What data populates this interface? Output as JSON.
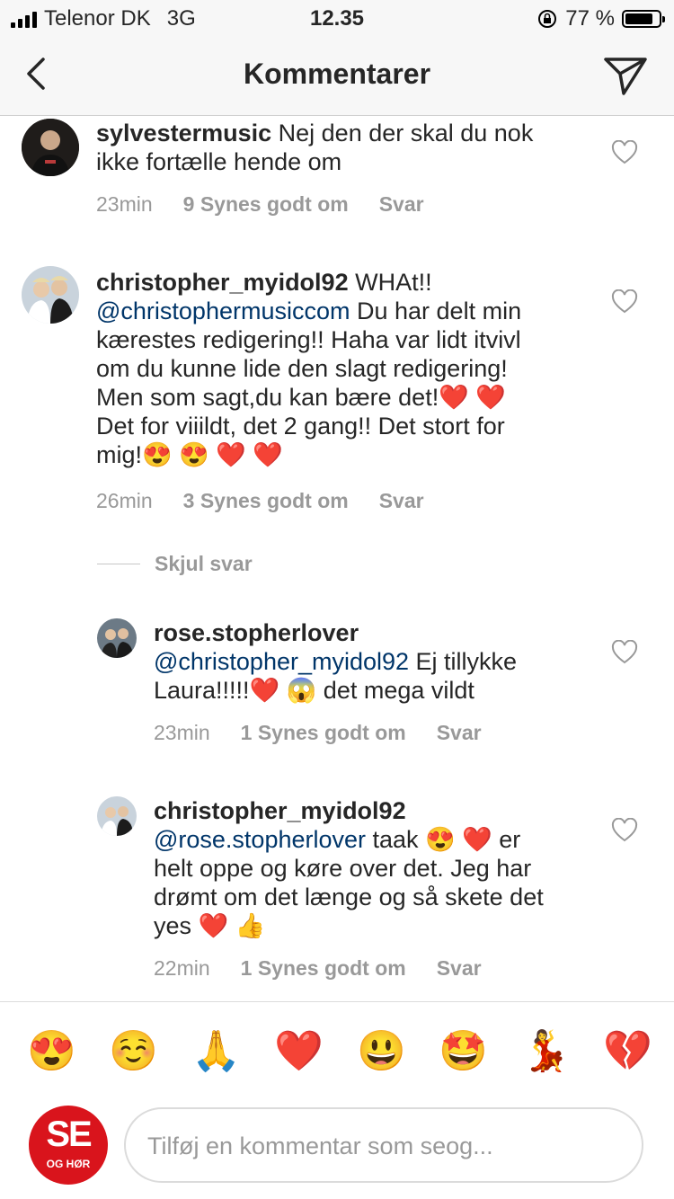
{
  "status_bar": {
    "carrier": "Telenor DK",
    "network": "3G",
    "time": "12.35",
    "battery": "77 %"
  },
  "header": {
    "title": "Kommentarer"
  },
  "comments": [
    {
      "username": "sylvestermusic",
      "lines": [
        [
          {
            "t": "Nej den der skal du nok"
          }
        ],
        [
          {
            "t": "ikke fortælle hende om"
          }
        ]
      ],
      "time": "23min",
      "likes": "9 Synes godt om",
      "reply": "Svar"
    },
    {
      "username": "christopher_myidol92",
      "lines": [
        [
          {
            "t": "WHAt!!"
          }
        ],
        [
          {
            "t": "@christophermusiccom",
            "m": true
          },
          {
            "t": " Du har delt min"
          }
        ],
        [
          {
            "t": "kærestes redigering!! Haha var lidt itvivl"
          }
        ],
        [
          {
            "t": "om du kunne lide den slagt redigering!"
          }
        ],
        [
          {
            "t": "Men som sagt,du kan bære det!❤️ ❤️"
          }
        ],
        [
          {
            "t": "Det for viiildt, det 2 gang!! Det stort for"
          }
        ],
        [
          {
            "t": "mig!😍 😍 ❤️ ❤️"
          }
        ]
      ],
      "time": "26min",
      "likes": "3 Synes godt om",
      "reply": "Svar"
    },
    {
      "username": "rose.stopherlover",
      "lines": [
        [
          {
            "t": "@christopher_myidol92",
            "m": true
          },
          {
            "t": " Ej tillykke"
          }
        ],
        [
          {
            "t": "Laura!!!!!❤️ 😱  det mega vildt"
          }
        ]
      ],
      "time": "23min",
      "likes": "1 Synes godt om",
      "reply": "Svar"
    },
    {
      "username": "christopher_myidol92",
      "lines": [
        [
          {
            "t": "@rose.stopherlover",
            "m": true
          },
          {
            "t": " taak 😍 ❤️ er"
          }
        ],
        [
          {
            "t": "helt oppe og køre over det. Jeg har"
          }
        ],
        [
          {
            "t": "drømt om det længe og så skete det"
          }
        ],
        [
          {
            "t": "yes ❤️ 👍"
          }
        ]
      ],
      "time": "22min",
      "likes": "1 Synes godt om",
      "reply": "Svar"
    }
  ],
  "hide_replies": "Skjul svar",
  "emoji_bar": [
    "😍",
    "☺️",
    "🙏",
    "❤️",
    "😃",
    "🤩",
    "💃",
    "💔"
  ],
  "input": {
    "placeholder": "Tilføj en kommentar som seog..."
  },
  "logo": {
    "top": "SE",
    "bottom": "OG HØR"
  }
}
